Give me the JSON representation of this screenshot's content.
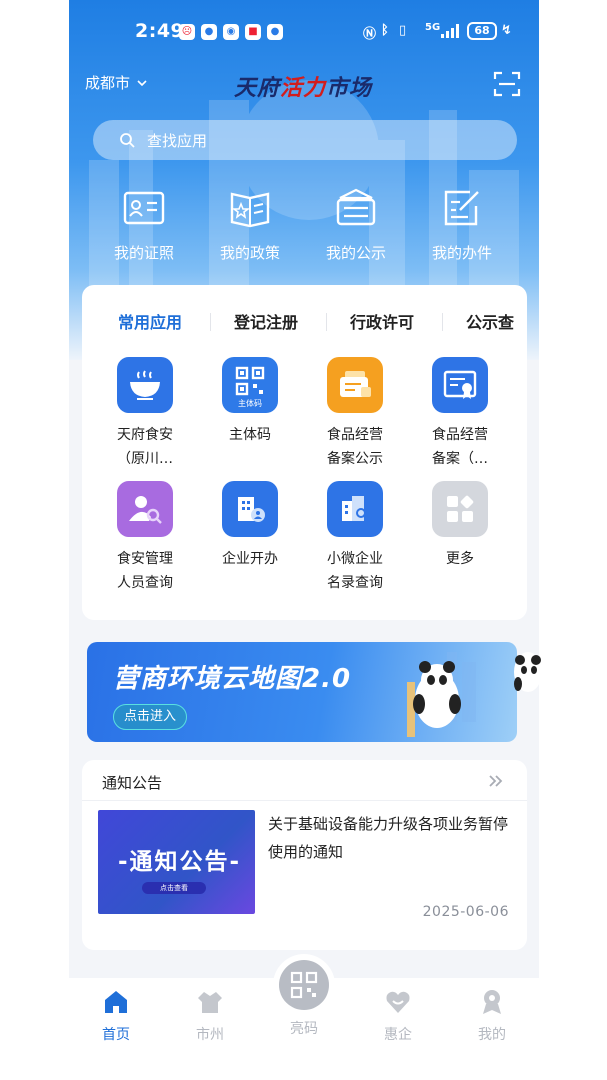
{
  "status_bar": {
    "time": "2:49",
    "network": "5G",
    "battery": "68"
  },
  "header": {
    "city": "成都市",
    "brand_part1": "天府",
    "brand_part2": "活力",
    "brand_part3": "市场",
    "search_placeholder": "查找应用"
  },
  "quick_actions": [
    {
      "label": "我的证照",
      "icon": "id-card-icon"
    },
    {
      "label": "我的政策",
      "icon": "policy-book-icon"
    },
    {
      "label": "我的公示",
      "icon": "notice-board-icon"
    },
    {
      "label": "我的办件",
      "icon": "document-edit-icon"
    }
  ],
  "app_tabs": [
    "常用应用",
    "登记注册",
    "行政许可",
    "公示查"
  ],
  "apps": [
    {
      "line1": "天府食安",
      "line2": "（原川…",
      "icon": "food-bowl-icon",
      "color": "#2e74e6"
    },
    {
      "line1": "主体码",
      "line2": "",
      "icon": "qr-code-icon",
      "color": "#2e7ae8",
      "badge": "主体码"
    },
    {
      "line1": "食品经营",
      "line2": "备案公示",
      "icon": "food-filing-notice-icon",
      "color": "#f5a020"
    },
    {
      "line1": "食品经营",
      "line2": "备案（…",
      "icon": "certificate-icon",
      "color": "#2e74e6"
    },
    {
      "line1": "食安管理",
      "line2": "人员查询",
      "icon": "person-search-icon",
      "color": "#a86be0"
    },
    {
      "line1": "企业开办",
      "line2": "",
      "icon": "building-person-icon",
      "color": "#2e74e6"
    },
    {
      "line1": "小微企业",
      "line2": "名录查询",
      "icon": "building-search-icon",
      "color": "#2e74e6"
    },
    {
      "line1": "更多",
      "line2": "",
      "icon": "more-grid-icon",
      "color": "#d4d7dd"
    }
  ],
  "banner": {
    "title": "营商环境云地图2.0",
    "button": "点击进入"
  },
  "notice": {
    "heading": "通知公告",
    "thumb_title": "-通知公告-",
    "thumb_button": "点击查看",
    "title": "关于基础设备能力升级各项业务暂停使用的通知",
    "date": "2025-06-06"
  },
  "bottom_nav": [
    {
      "label": "首页",
      "icon": "home-icon",
      "active": true
    },
    {
      "label": "市州",
      "icon": "city-cloth-icon",
      "active": false
    },
    {
      "label": "亮码",
      "icon": "qr-code-icon",
      "active": false
    },
    {
      "label": "惠企",
      "icon": "heart-icon",
      "active": false
    },
    {
      "label": "我的",
      "icon": "profile-icon",
      "active": false
    }
  ],
  "colors": {
    "primary": "#1f6fd8",
    "header_top": "#1f7ee3",
    "inactive": "#b4b8c0"
  }
}
